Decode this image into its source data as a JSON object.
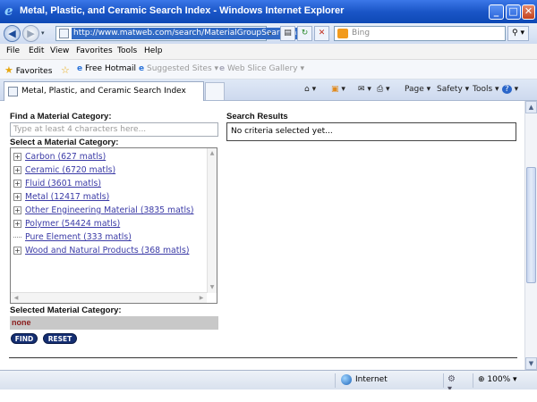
{
  "window": {
    "title": "Metal, Plastic, and Ceramic Search Index - Windows Internet Explorer",
    "buttons": {
      "minimize": "_",
      "maximize": "□",
      "close": "✕"
    }
  },
  "address_bar": {
    "url": "http://www.matweb.com/search/MaterialGroupSearch.aspx",
    "search_placeholder": "Bing"
  },
  "menu": [
    "File",
    "Edit",
    "View",
    "Favorites",
    "Tools",
    "Help"
  ],
  "favorites_bar": {
    "favorites_label": "Favorites",
    "items": [
      "Free Hotmail",
      "Suggested Sites ▾",
      "Web Slice Gallery ▾"
    ]
  },
  "tab": {
    "label": "Metal, Plastic, and Ceramic Search Index"
  },
  "command_bar": {
    "page": "Page ▾",
    "safety": "Safety ▾",
    "tools": "Tools ▾",
    "help": "▾"
  },
  "page": {
    "find_heading": "Find a Material Category:",
    "find_placeholder": "Type at least 4 characters here...",
    "select_heading": "Select a Material Category:",
    "categories": [
      {
        "label": "Carbon (627 matls)",
        "expandable": true
      },
      {
        "label": "Ceramic (6720 matls)",
        "expandable": true
      },
      {
        "label": "Fluid (3601 matls)",
        "expandable": true
      },
      {
        "label": "Metal (12417 matls)",
        "expandable": true
      },
      {
        "label": "Other Engineering Material (3835 matls)",
        "expandable": true
      },
      {
        "label": "Polymer (54424 matls)",
        "expandable": true
      },
      {
        "label": "Pure Element (333 matls)",
        "expandable": false
      },
      {
        "label": "Wood and Natural Products (368 matls)",
        "expandable": true
      }
    ],
    "selected_heading": "Selected Material Category:",
    "selected_value": "none",
    "find_button": "FIND",
    "reset_button": "RESET",
    "results_heading": "Search Results",
    "results_text": "No criteria selected yet..."
  },
  "status_bar": {
    "zone": "Internet",
    "zoom": "100%"
  }
}
